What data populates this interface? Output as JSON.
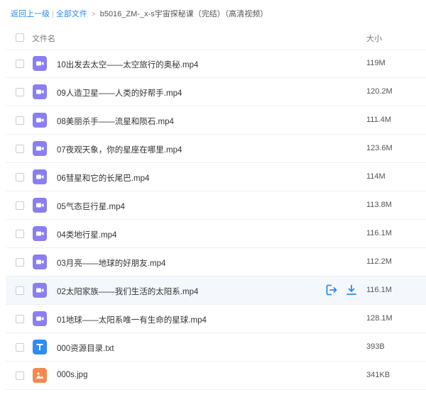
{
  "breadcrumb": {
    "back": "返回上一级",
    "separator": "|",
    "all_files": "全部文件",
    "arrow": ">",
    "current": "b5016_ZM-_x-s宇宙探秘课（完结）（高清视频）"
  },
  "header": {
    "name_col": "文件名",
    "size_col": "大小"
  },
  "colors": {
    "link": "#2a8cf0",
    "video_icon": "#8b7ef0",
    "txt_icon": "#2f8cf5",
    "img_icon": "#f6884f",
    "hover_row": "#f4f8fd"
  },
  "files": [
    {
      "name": "10出发去太空——太空旅行的奥秘.mp4",
      "size": "119M",
      "type": "video-icon"
    },
    {
      "name": "09人造卫星——人类的好帮手.mp4",
      "size": "120.2M",
      "type": "video-icon"
    },
    {
      "name": "08美丽杀手——流星和陨石.mp4",
      "size": "111.4M",
      "type": "video-icon"
    },
    {
      "name": "07夜观天象，你的星座在哪里.mp4",
      "size": "123.6M",
      "type": "video-icon"
    },
    {
      "name": "06彗星和它的长尾巴.mp4",
      "size": "114M",
      "type": "video-icon"
    },
    {
      "name": "05气态巨行星.mp4",
      "size": "113.8M",
      "type": "video-icon"
    },
    {
      "name": "04类地行星.mp4",
      "size": "116.1M",
      "type": "video-icon"
    },
    {
      "name": "03月亮——地球的好朋友.mp4",
      "size": "112.2M",
      "type": "video-icon"
    },
    {
      "name": "02太阳家族——我们生活的太阳系.mp4",
      "size": "116.1M",
      "type": "video-icon",
      "hovered": true
    },
    {
      "name": "01地球——太阳系唯一有生命的星球.mp4",
      "size": "128.1M",
      "type": "video-icon"
    },
    {
      "name": "000资源目录.txt",
      "size": "393B",
      "type": "text-file-icon"
    },
    {
      "name": "000s.jpg",
      "size": "341KB",
      "type": "image-file-icon"
    }
  ]
}
